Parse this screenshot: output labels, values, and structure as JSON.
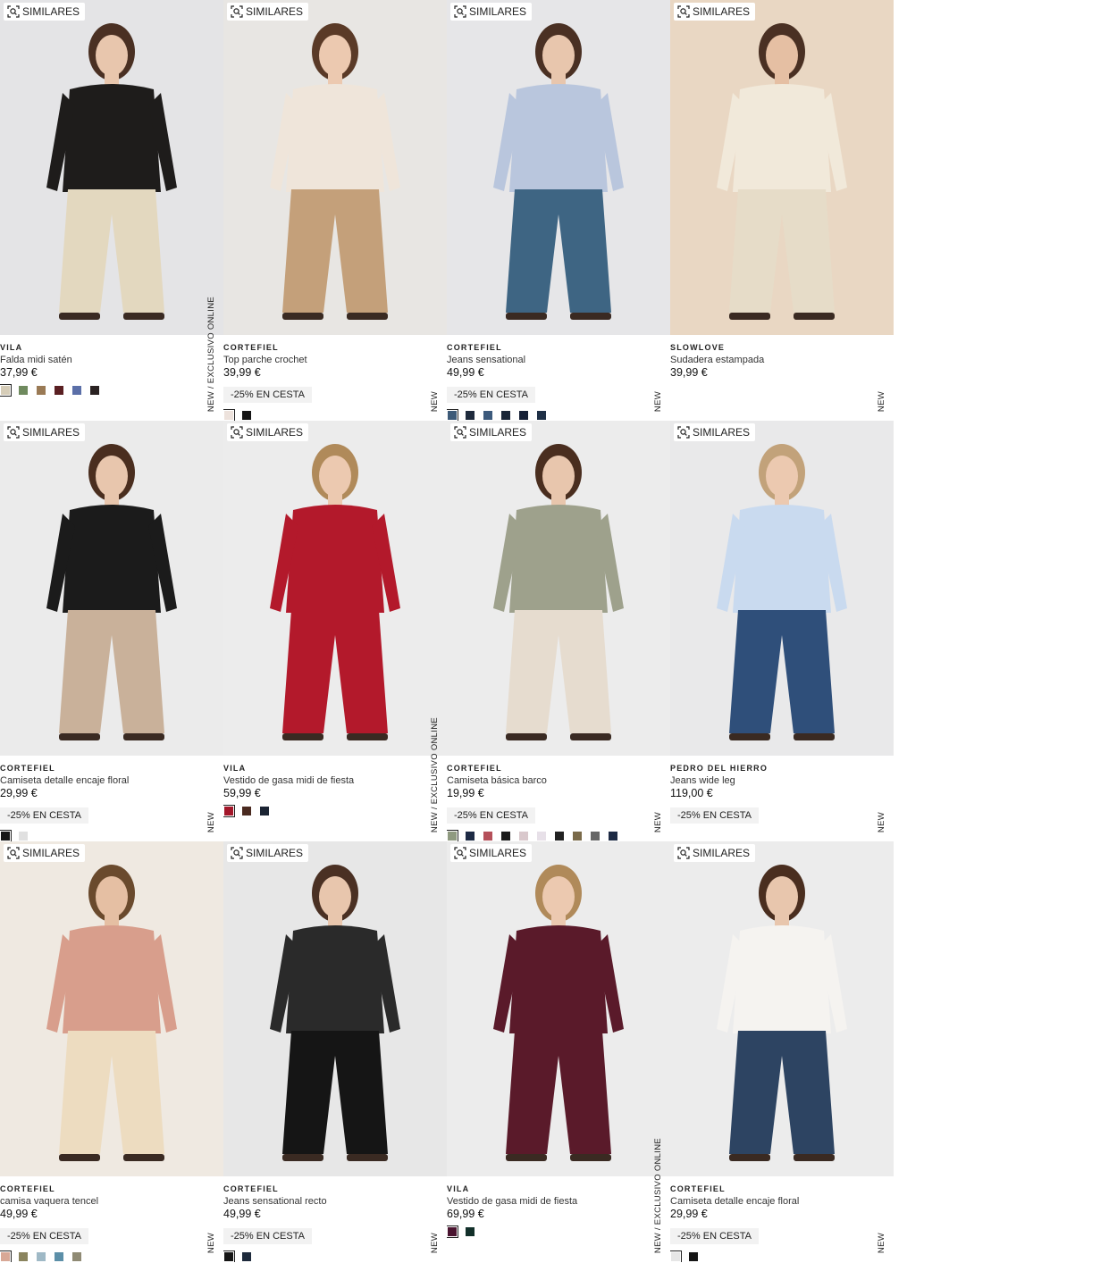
{
  "similar_label": "SIMILARES",
  "products": [
    {
      "brand": "VILA",
      "name": "Falda midi satén",
      "price": "37,99 €",
      "tag": "NEW  /  EXCLUSIVO ONLINE",
      "promo": "",
      "swatches": [
        "#d6cdb8",
        "#6f8a5e",
        "#9a7a55",
        "#5a1f22",
        "#5b6fa8",
        "#2a2222"
      ],
      "bg": "#e4e4e6",
      "top": "#1e1c1b",
      "bottom": "#e3d8bf",
      "skin": "#e8c6ad",
      "hair": "#4a3023"
    },
    {
      "brand": "CORTEFIEL",
      "name": "Top parche crochet",
      "price": "39,99 €",
      "tag": "NEW",
      "promo": "-25% EN CESTA",
      "swatches": [
        "#ede2dc",
        "#151515"
      ],
      "bg": "#e8e6e3",
      "top": "#efe5da",
      "bottom": "#c4a07a",
      "skin": "#ecc9b0",
      "hair": "#5a3a27"
    },
    {
      "brand": "CORTEFIEL",
      "name": "Jeans sensational",
      "price": "49,99 €",
      "tag": "NEW",
      "promo": "-25% EN CESTA",
      "swatches": [
        "#3d5a78",
        "#1e2a3c",
        "#3c5a7c",
        "#1a2638",
        "#162036",
        "#1f3046"
      ],
      "bg": "#e6e6e8",
      "top": "#b9c6dd",
      "bottom": "#3e6583",
      "skin": "#e8c6ad",
      "hair": "#4a3023"
    },
    {
      "brand": "SLOWLOVE",
      "name": "Sudadera estampada",
      "price": "39,99 €",
      "tag": "NEW",
      "promo": "",
      "swatches": [],
      "bg": "#e9d7c3",
      "top": "#f1e9da",
      "bottom": "#e6dcc8",
      "skin": "#e5bfa3",
      "hair": "#4a3023"
    },
    {
      "brand": "CORTEFIEL",
      "name": "Camiseta detalle encaje floral",
      "price": "29,99 €",
      "tag": "NEW",
      "promo": "-25% EN CESTA",
      "swatches": [
        "#151515",
        "#e0e0e0"
      ],
      "bg": "#ebebeb",
      "top": "#1b1b1b",
      "bottom": "#c9b19a",
      "skin": "#e8c6ad",
      "hair": "#4a2e1f"
    },
    {
      "brand": "VILA",
      "name": "Vestido de gasa midi de fiesta",
      "price": "59,99 €",
      "tag": "NEW  /  EXCLUSIVO ONLINE",
      "promo": "",
      "swatches": [
        "#a3172a",
        "#4a2a20",
        "#1b2433"
      ],
      "bg": "#ececec",
      "top": "#b3192b",
      "bottom": "#b3192b",
      "skin": "#ecc9b0",
      "hair": "#b08a5a"
    },
    {
      "brand": "CORTEFIEL",
      "name": "Camiseta básica barco",
      "price": "19,99 €",
      "tag": "NEW",
      "promo": "-25% EN CESTA",
      "swatches": [
        "#8f9a80",
        "#1d2a44",
        "#b5505a",
        "#1b1b1b",
        "#d9c8cc",
        "#e7e0e8",
        "#222222",
        "#7a6a4a",
        "#666666",
        "#1d2a44"
      ],
      "bg": "#ececec",
      "top": "#9ea18c",
      "bottom": "#e6dccf",
      "skin": "#e8c6ad",
      "hair": "#4a2e1f"
    },
    {
      "brand": "PEDRO DEL HIERRO",
      "name": "Jeans wide leg",
      "price": "119,00 €",
      "tag": "NEW",
      "promo": "-25% EN CESTA",
      "swatches": [],
      "bg": "#e9e9ea",
      "top": "#c9daef",
      "bottom": "#2f4f7a",
      "skin": "#ecc9b0",
      "hair": "#c2a27a"
    },
    {
      "brand": "CORTEFIEL",
      "name": "camisa vaquera tencel",
      "price": "49,99 €",
      "tag": "NEW",
      "promo": "-25% EN CESTA",
      "swatches": [
        "#d8a896",
        "#8a845e",
        "#9fb9c6",
        "#5c8fa8",
        "#8f8a74"
      ],
      "bg": "#efe9e1",
      "top": "#d89e8c",
      "bottom": "#eddcc0",
      "skin": "#e5bfa3",
      "hair": "#6a4a2d"
    },
    {
      "brand": "CORTEFIEL",
      "name": "Jeans sensational recto",
      "price": "49,99 €",
      "tag": "NEW",
      "promo": "-25% EN CESTA",
      "swatches": [
        "#151515",
        "#1e2a3c"
      ],
      "bg": "#e7e7e7",
      "top": "#2a2a2a",
      "bottom": "#151515",
      "skin": "#e8c6ad",
      "hair": "#4a3023"
    },
    {
      "brand": "VILA",
      "name": "Vestido de gasa midi de fiesta",
      "price": "69,99 €",
      "tag": "NEW  /  EXCLUSIVO ONLINE",
      "promo": "",
      "swatches": [
        "#4a1430",
        "#12302a"
      ],
      "bg": "#ececec",
      "top": "#5a1a2a",
      "bottom": "#5a1a2a",
      "skin": "#ecc9b0",
      "hair": "#b08a5a"
    },
    {
      "brand": "CORTEFIEL",
      "name": "Camiseta detalle encaje floral",
      "price": "29,99 €",
      "tag": "NEW",
      "promo": "-25% EN CESTA",
      "swatches": [
        "#e6e6e6",
        "#151515"
      ],
      "bg": "#ececec",
      "top": "#f5f3f0",
      "bottom": "#2d4462",
      "skin": "#e8c6ad",
      "hair": "#4a2e1f"
    }
  ]
}
